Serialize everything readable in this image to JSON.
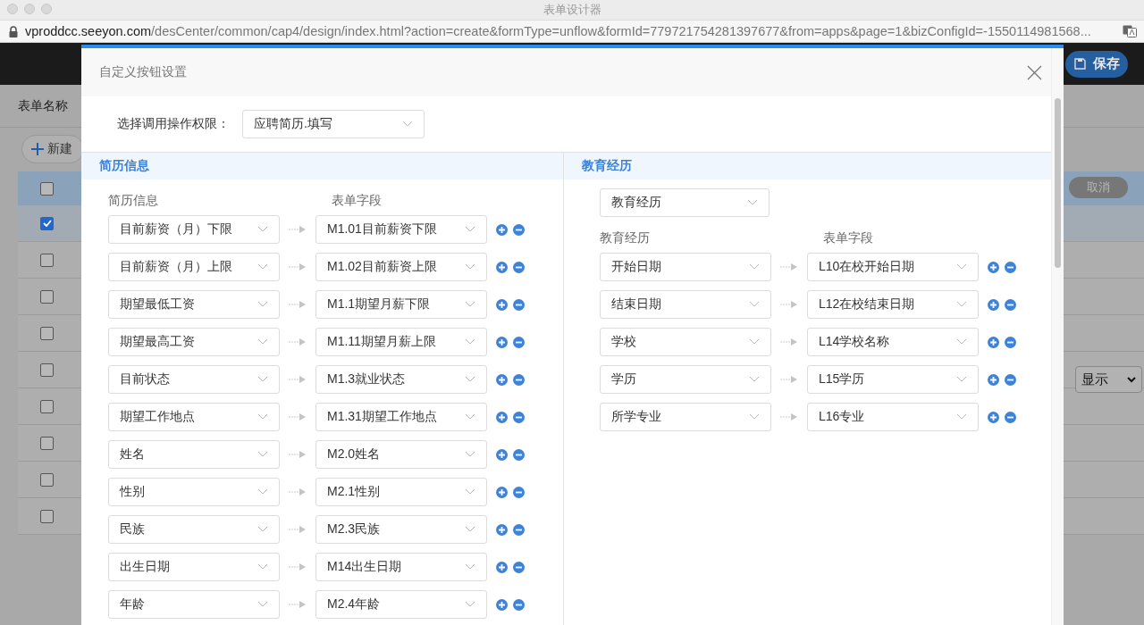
{
  "window": {
    "title": "表单设计器",
    "url_host": "vproddcc.seeyon.com",
    "url_path": "/desCenter/common/cap4/design/index.html?action=create&formType=unflow&formId=779721754281397677&from=apps&page=1&bizConfigId=-1550114981568..."
  },
  "app": {
    "save_button": "保存",
    "form_name_label": "表单名称",
    "new_button": "新建",
    "cancel_button": "取消",
    "display_select": "显示",
    "table": {
      "header_checked": false,
      "rows": [
        {
          "checked": true
        },
        {
          "checked": false
        },
        {
          "checked": false
        },
        {
          "checked": false
        },
        {
          "checked": false
        },
        {
          "checked": false
        },
        {
          "checked": false
        },
        {
          "checked": false
        },
        {
          "checked": false
        }
      ]
    }
  },
  "dialog": {
    "title": "自定义按钮设置",
    "permission_label": "选择调用操作权限：",
    "permission_select": "应聘简历.填写",
    "sections": [
      {
        "title": "简历信息",
        "columns": [
          "简历信息",
          "表单字段"
        ],
        "rows": [
          {
            "source": "目前薪资（月）下限",
            "target": "M1.01目前薪资下限"
          },
          {
            "source": "目前薪资（月）上限",
            "target": "M1.02目前薪资上限"
          },
          {
            "source": "期望最低工资",
            "target": "M1.1期望月薪下限"
          },
          {
            "source": "期望最高工资",
            "target": "M1.11期望月薪上限"
          },
          {
            "source": "目前状态",
            "target": "M1.3就业状态"
          },
          {
            "source": "期望工作地点",
            "target": "M1.31期望工作地点"
          },
          {
            "source": "姓名",
            "target": "M2.0姓名"
          },
          {
            "source": "性别",
            "target": "M2.1性别"
          },
          {
            "source": "民族",
            "target": "M2.3民族"
          },
          {
            "source": "出生日期",
            "target": "M14出生日期"
          },
          {
            "source": "年龄",
            "target": "M2.4年龄"
          }
        ]
      },
      {
        "title": "教育经历",
        "table_select": "教育经历",
        "columns": [
          "教育经历",
          "表单字段"
        ],
        "rows": [
          {
            "source": "开始日期",
            "target": "L10在校开始日期"
          },
          {
            "source": "结束日期",
            "target": "L12在校结束日期"
          },
          {
            "source": "学校",
            "target": "L14学校名称"
          },
          {
            "source": "学历",
            "target": "L15学历"
          },
          {
            "source": "所学专业",
            "target": "L16专业"
          }
        ]
      }
    ]
  }
}
